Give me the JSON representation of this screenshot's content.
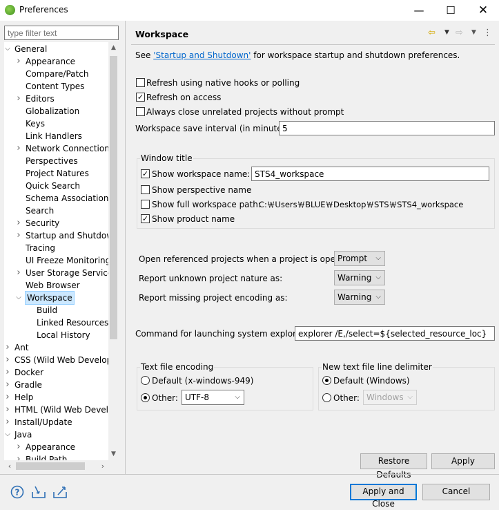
{
  "window": {
    "title": "Preferences",
    "min": "—",
    "max": "☐",
    "close": "✕"
  },
  "filter": {
    "placeholder": "type filter text"
  },
  "tree": [
    {
      "label": "General",
      "depth": 0,
      "twisty": "open"
    },
    {
      "label": "Appearance",
      "depth": 1,
      "twisty": "closed"
    },
    {
      "label": "Compare/Patch",
      "depth": 1,
      "twisty": "none"
    },
    {
      "label": "Content Types",
      "depth": 1,
      "twisty": "none"
    },
    {
      "label": "Editors",
      "depth": 1,
      "twisty": "closed"
    },
    {
      "label": "Globalization",
      "depth": 1,
      "twisty": "none"
    },
    {
      "label": "Keys",
      "depth": 1,
      "twisty": "none"
    },
    {
      "label": "Link Handlers",
      "depth": 1,
      "twisty": "none"
    },
    {
      "label": "Network Connections",
      "depth": 1,
      "twisty": "closed"
    },
    {
      "label": "Perspectives",
      "depth": 1,
      "twisty": "none"
    },
    {
      "label": "Project Natures",
      "depth": 1,
      "twisty": "none"
    },
    {
      "label": "Quick Search",
      "depth": 1,
      "twisty": "none"
    },
    {
      "label": "Schema Associations",
      "depth": 1,
      "twisty": "none"
    },
    {
      "label": "Search",
      "depth": 1,
      "twisty": "none"
    },
    {
      "label": "Security",
      "depth": 1,
      "twisty": "closed"
    },
    {
      "label": "Startup and Shutdown",
      "depth": 1,
      "twisty": "closed"
    },
    {
      "label": "Tracing",
      "depth": 1,
      "twisty": "none"
    },
    {
      "label": "UI Freeze Monitoring",
      "depth": 1,
      "twisty": "none"
    },
    {
      "label": "User Storage Service",
      "depth": 1,
      "twisty": "closed"
    },
    {
      "label": "Web Browser",
      "depth": 1,
      "twisty": "none"
    },
    {
      "label": "Workspace",
      "depth": 1,
      "twisty": "open",
      "selected": true
    },
    {
      "label": "Build",
      "depth": 2,
      "twisty": "none"
    },
    {
      "label": "Linked Resources",
      "depth": 2,
      "twisty": "none"
    },
    {
      "label": "Local History",
      "depth": 2,
      "twisty": "none"
    },
    {
      "label": "Ant",
      "depth": 0,
      "twisty": "closed"
    },
    {
      "label": "CSS (Wild Web Developer)",
      "depth": 0,
      "twisty": "closed"
    },
    {
      "label": "Docker",
      "depth": 0,
      "twisty": "closed"
    },
    {
      "label": "Gradle",
      "depth": 0,
      "twisty": "closed"
    },
    {
      "label": "Help",
      "depth": 0,
      "twisty": "closed"
    },
    {
      "label": "HTML (Wild Web Developer)",
      "depth": 0,
      "twisty": "closed"
    },
    {
      "label": "Install/Update",
      "depth": 0,
      "twisty": "closed"
    },
    {
      "label": "Java",
      "depth": 0,
      "twisty": "open"
    },
    {
      "label": "Appearance",
      "depth": 1,
      "twisty": "closed"
    },
    {
      "label": "Build Path",
      "depth": 1,
      "twisty": "closed"
    }
  ],
  "page": {
    "title": "Workspace",
    "see_prefix": "See ",
    "see_link": "'Startup and Shutdown'",
    "see_suffix": " for workspace startup and shutdown preferences.",
    "refresh_native": {
      "label": "Refresh using native hooks or polling",
      "checked": false
    },
    "refresh_access": {
      "label": "Refresh on access",
      "checked": true
    },
    "close_unrelated": {
      "label": "Always close unrelated projects without prompt",
      "checked": false
    },
    "save_interval_label": "Workspace save interval (in minutes):",
    "save_interval_value": "5",
    "window_title": {
      "legend": "Window title",
      "show_ws_name": {
        "label": "Show workspace name:",
        "checked": true
      },
      "ws_name_value": "STS4_workspace",
      "show_perspective": {
        "label": "Show perspective name",
        "checked": false
      },
      "show_full_path": {
        "label": "Show full workspace path:",
        "checked": false
      },
      "full_path_value": "C:￦Users￦BLUE￦Desktop￦STS￦STS4_workspace",
      "show_product": {
        "label": "Show product name",
        "checked": true
      }
    },
    "open_ref_label": "Open referenced projects when a project is opened:",
    "open_ref_value": "Prompt",
    "unknown_nature_label": "Report unknown project nature as:",
    "unknown_nature_value": "Warning",
    "missing_enc_label": "Report missing project encoding as:",
    "missing_enc_value": "Warning",
    "explorer_label": "Command for launching system explorer:",
    "explorer_value": "explorer /E,/select=${selected_resource_loc}",
    "encoding": {
      "legend": "Text file encoding",
      "default_label": "Default (x-windows-949)",
      "other_label": "Other:",
      "other_value": "UTF-8",
      "selected": "other"
    },
    "delimiter": {
      "legend": "New text file line delimiter",
      "default_label": "Default (Windows)",
      "other_label": "Other:",
      "other_value": "Windows",
      "selected": "default"
    },
    "restore_defaults": "Restore Defaults",
    "apply": "Apply"
  },
  "footer": {
    "apply_close": "Apply and Close",
    "cancel": "Cancel",
    "icons": [
      "help-icon",
      "import-icon",
      "export-icon"
    ]
  }
}
